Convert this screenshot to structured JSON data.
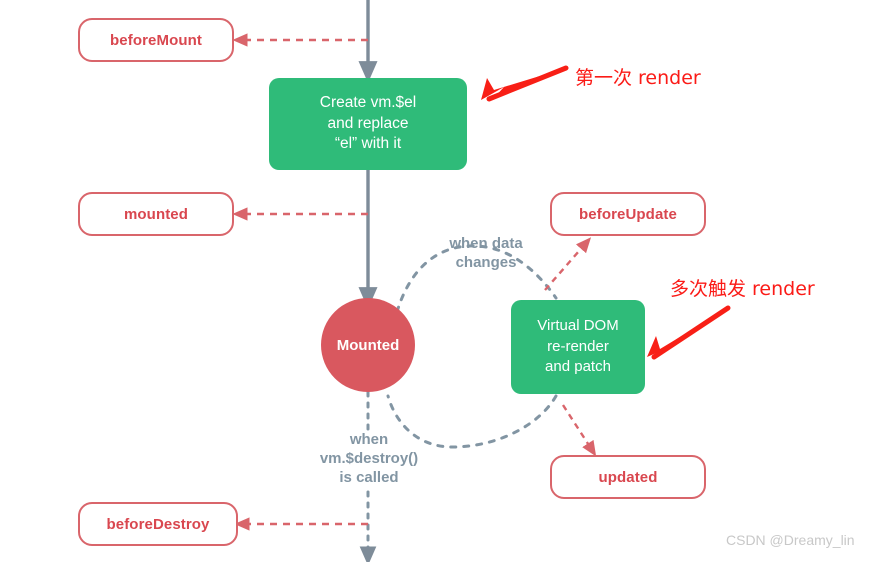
{
  "diagram": {
    "title": "Vue instance lifecycle (mount / update / destroy)",
    "colors": {
      "green": "#2fbb79",
      "red_pill_border": "#d9656b",
      "red_pill_text": "#d9474f",
      "circle": "#d9585f",
      "gray_flow": "#7e8c99",
      "gray_text": "#8295a3",
      "annotation_red": "#fb1b17",
      "watermark": "#c8c8c8",
      "background": "#ffffff"
    },
    "hooks": [
      {
        "id": "beforeMount",
        "label": "beforeMount"
      },
      {
        "id": "mounted",
        "label": "mounted"
      },
      {
        "id": "beforeUpdate",
        "label": "beforeUpdate"
      },
      {
        "id": "updated",
        "label": "updated"
      },
      {
        "id": "beforeDestroy",
        "label": "beforeDestroy"
      }
    ],
    "steps": [
      {
        "id": "create-el",
        "label": "Create vm.$el\nand replace\n“el” with it"
      },
      {
        "id": "virtual-dom",
        "label": "Virtual DOM\nre-render\nand patch"
      }
    ],
    "state": {
      "id": "mounted-state",
      "label": "Mounted"
    },
    "flow_labels": [
      {
        "id": "when-data-changes",
        "label": "when data\nchanges"
      },
      {
        "id": "when-destroy-called",
        "label": "when\nvm.$destroy()\nis called"
      }
    ],
    "annotations": [
      {
        "id": "first-render",
        "label": "第一次 render"
      },
      {
        "id": "multiple-render",
        "label": "多次触发 render"
      }
    ],
    "watermark": "CSDN @Dreamy_lin"
  }
}
